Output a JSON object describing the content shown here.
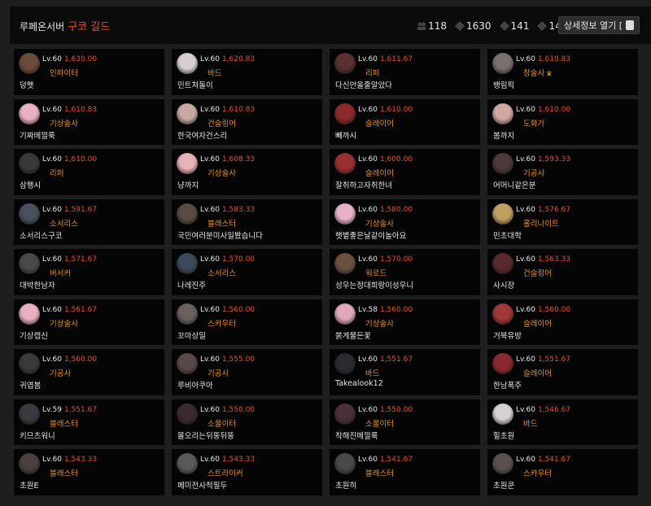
{
  "header": {
    "server": "루페온서버",
    "guild": "구코 길드",
    "stats": [
      {
        "icon": "members-icon",
        "value": "118"
      },
      {
        "icon": "rank-icon",
        "value": "1630"
      },
      {
        "icon": "rank-icon",
        "value": "141"
      },
      {
        "icon": "rank-icon",
        "value": "1489"
      }
    ],
    "detail_label": "상세정보 열기 ["
  },
  "members": [
    {
      "level": "Lv.60",
      "score": "1,630.00",
      "cls": "인파이터",
      "name": "덩햇",
      "avatar": "#6a4a3a",
      "crown": ""
    },
    {
      "level": "Lv.60",
      "score": "1,620.83",
      "cls": "바드",
      "name": "민트쳐돌이",
      "avatar": "#d8d0d0",
      "crown": ""
    },
    {
      "level": "Lv.60",
      "score": "1,611.67",
      "cls": "리퍼",
      "name": "다신안올줄알았다",
      "avatar": "#5a3030",
      "crown": ""
    },
    {
      "level": "Lv.60",
      "score": "1,610.83",
      "cls": "창술사",
      "name": "뱅림픽",
      "avatar": "#7a7070",
      "crown": "♛"
    },
    {
      "level": "Lv.60",
      "score": "1,610.83",
      "cls": "기상술사",
      "name": "기짜메껄룩",
      "avatar": "#e8b0c0",
      "crown": ""
    },
    {
      "level": "Lv.60",
      "score": "1,610.83",
      "cls": "건슬링어",
      "name": "한국여자건스리",
      "avatar": "#c8a8a0",
      "crown": ""
    },
    {
      "level": "Lv.60",
      "score": "1,610.00",
      "cls": "슬레이어",
      "name": "빼까시",
      "avatar": "#8a2a2a",
      "crown": ""
    },
    {
      "level": "Lv.60",
      "score": "1,610.00",
      "cls": "도화가",
      "name": "봄까지",
      "avatar": "#d0a8a0",
      "crown": ""
    },
    {
      "level": "Lv.60",
      "score": "1,610.00",
      "cls": "리퍼",
      "name": "삼행시",
      "avatar": "#3a3838",
      "crown": ""
    },
    {
      "level": "Lv.60",
      "score": "1,608.33",
      "cls": "기상술사",
      "name": "냥까지",
      "avatar": "#e8b0b8",
      "crown": ""
    },
    {
      "level": "Lv.60",
      "score": "1,600.00",
      "cls": "슬레이어",
      "name": "잘취하고자취한녀",
      "avatar": "#9a3030",
      "crown": ""
    },
    {
      "level": "Lv.60",
      "score": "1,593.33",
      "cls": "기공사",
      "name": "어머니같은분",
      "avatar": "#4a3a3a",
      "crown": ""
    },
    {
      "level": "Lv.60",
      "score": "1,591.67",
      "cls": "소서리스",
      "name": "소서리스구코",
      "avatar": "#4a5060",
      "crown": ""
    },
    {
      "level": "Lv.60",
      "score": "1,583.33",
      "cls": "블래스터",
      "name": "국민여러분미사일봤습니다",
      "avatar": "#5a4a40",
      "crown": ""
    },
    {
      "level": "Lv.60",
      "score": "1,580.00",
      "cls": "기상술사",
      "name": "햇볕좋은날같이놀아요",
      "avatar": "#e8b0c8",
      "crown": ""
    },
    {
      "level": "Lv.60",
      "score": "1,576.67",
      "cls": "홀리나이트",
      "name": "민초대학",
      "avatar": "#c0a060",
      "crown": ""
    },
    {
      "level": "Lv.60",
      "score": "1,571.67",
      "cls": "버서커",
      "name": "대박한남자",
      "avatar": "#4a4848",
      "crown": ""
    },
    {
      "level": "Lv.60",
      "score": "1,570.00",
      "cls": "소서리스",
      "name": "나레진주",
      "avatar": "#3a4a5a",
      "crown": ""
    },
    {
      "level": "Lv.60",
      "score": "1,570.00",
      "cls": "워로드",
      "name": "성우는정대희랑이성우니",
      "avatar": "#6a5040",
      "crown": ""
    },
    {
      "level": "Lv.60",
      "score": "1,563.33",
      "cls": "건슬링어",
      "name": "사시장",
      "avatar": "#5a2a30",
      "crown": ""
    },
    {
      "level": "Lv.60",
      "score": "1,561.67",
      "cls": "기상술사",
      "name": "기상캡신",
      "avatar": "#e8b0c0",
      "crown": ""
    },
    {
      "level": "Lv.60",
      "score": "1,560.00",
      "cls": "스카우터",
      "name": "꼬마상일",
      "avatar": "#6a6060",
      "crown": ""
    },
    {
      "level": "Lv.58",
      "score": "1,560.00",
      "cls": "기상술사",
      "name": "붉게물든꽃",
      "avatar": "#e0a8b8",
      "crown": ""
    },
    {
      "level": "Lv.60",
      "score": "1,560.00",
      "cls": "슬레이어",
      "name": "거북유방",
      "avatar": "#a03838",
      "crown": ""
    },
    {
      "level": "Lv.60",
      "score": "1,560.00",
      "cls": "기공사",
      "name": "귀엽봄",
      "avatar": "#3a3a3a",
      "crown": ""
    },
    {
      "level": "Lv.60",
      "score": "1,555.00",
      "cls": "기공사",
      "name": "루비아쿠아",
      "avatar": "#5a4848",
      "crown": ""
    },
    {
      "level": "Lv.60",
      "score": "1,551.67",
      "cls": "바드",
      "name": "Takealook12",
      "avatar": "#2a2a30",
      "crown": ""
    },
    {
      "level": "Lv.60",
      "score": "1,551.67",
      "cls": "슬레이어",
      "name": "한남폭주",
      "avatar": "#8a2a30",
      "crown": ""
    },
    {
      "level": "Lv.59",
      "score": "1,551.67",
      "cls": "블래스터",
      "name": "키므츠워니",
      "avatar": "#3a3a40",
      "crown": ""
    },
    {
      "level": "Lv.60",
      "score": "1,550.00",
      "cls": "소울이터",
      "name": "몰오리는뒤뚱뒤뚱",
      "avatar": "#3a2a30",
      "crown": ""
    },
    {
      "level": "Lv.60",
      "score": "1,550.00",
      "cls": "소울이터",
      "name": "착해진메껄룩",
      "avatar": "#4a3038",
      "crown": ""
    },
    {
      "level": "Lv.60",
      "score": "1,546.67",
      "cls": "바드",
      "name": "힐초원",
      "avatar": "#d8d0d4",
      "crown": ""
    },
    {
      "level": "Lv.60",
      "score": "1,543.33",
      "cls": "블래스터",
      "name": "초원E",
      "avatar": "#4a4040",
      "crown": ""
    },
    {
      "level": "Lv.60",
      "score": "1,543.33",
      "cls": "스트라이커",
      "name": "페미전사척필두",
      "avatar": "#5a5858",
      "crown": ""
    },
    {
      "level": "Lv.60",
      "score": "1,541.67",
      "cls": "블래스터",
      "name": "초원히",
      "avatar": "#4a4848",
      "crown": ""
    },
    {
      "level": "Lv.60",
      "score": "1,541.67",
      "cls": "스카우터",
      "name": "초원쿤",
      "avatar": "#5a5050",
      "crown": ""
    }
  ]
}
